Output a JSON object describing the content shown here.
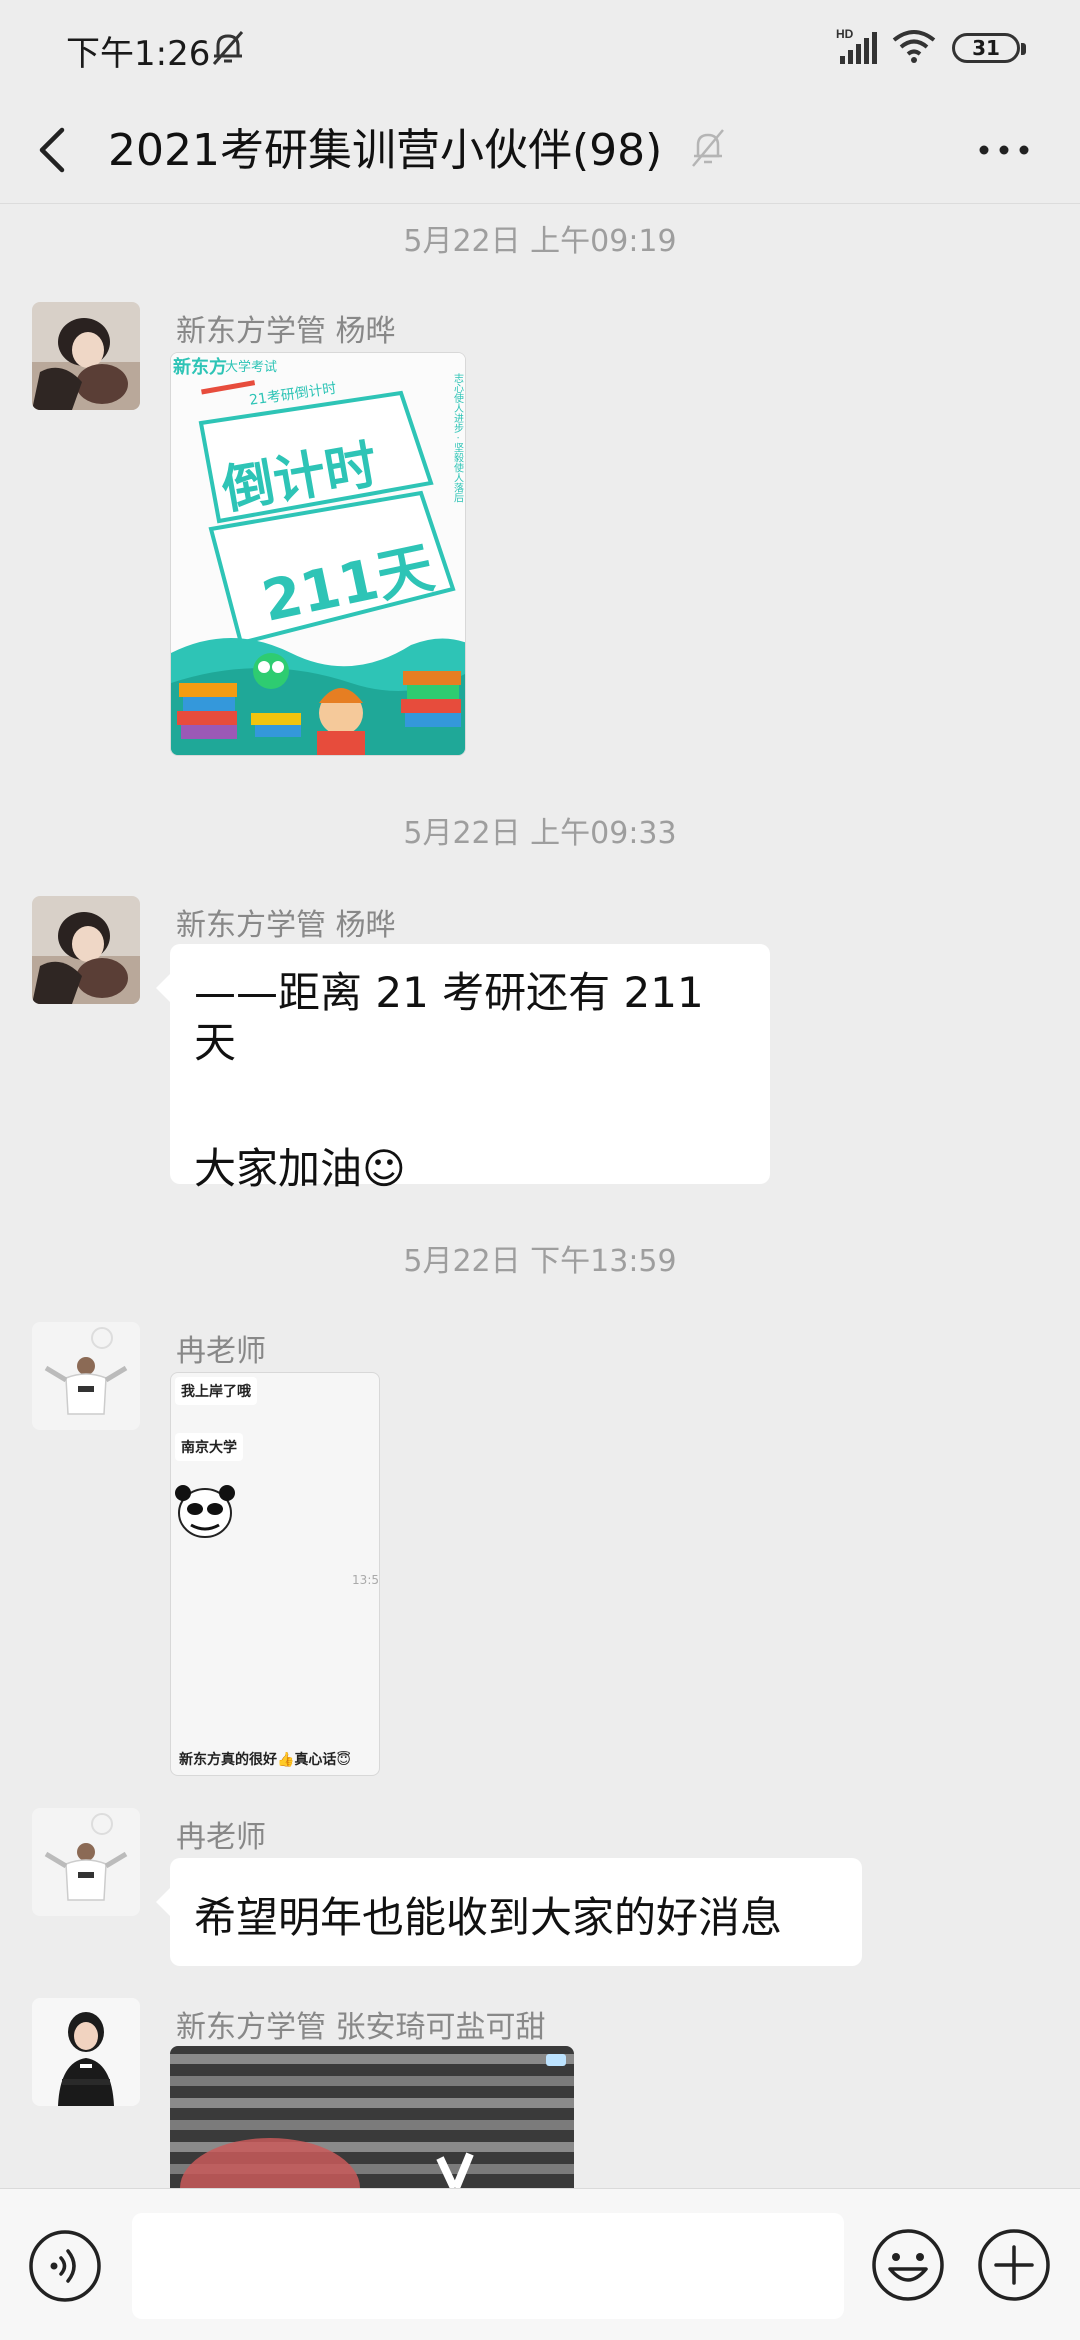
{
  "status_bar": {
    "time": "下午1:26",
    "network_label": "HD",
    "battery": "31"
  },
  "header": {
    "title": "2021考研集训营小伙伴(98)"
  },
  "messages": {
    "ts1": "5月22日 上午09:19",
    "m1_sender": "新东方学管  杨晔",
    "poster": {
      "brand": "新东方",
      "sub": "大学考试",
      "ribbon": "21考研倒计时",
      "big_title": "倒计时",
      "days": "211天",
      "side_text": "志心使人进步 · 坚毅使人落后"
    },
    "ts2": "5月22日 上午09:33",
    "m2_sender": "新东方学管  杨晔",
    "m2_line1": "——距离 21 考研还有 211 天",
    "m2_line2": "大家加油☺",
    "ts3": "5月22日 下午13:59",
    "m3_sender": "冉老师",
    "screenshot": {
      "line1": "我上岸了哦",
      "line2": "南京大学",
      "time": "13:5",
      "caption": "新东方真的很好👍真心话😇"
    },
    "m4_sender": "冉老师",
    "m4_text": "希望明年也能收到大家的好消息",
    "m5_sender": "新东方学管 张安琦可盐可甜"
  },
  "icons": {
    "back": "back-arrow-icon",
    "mute": "bell-off-icon",
    "more": "more-dots-icon",
    "voice": "voice-icon",
    "emoji": "emoji-icon",
    "plus": "plus-icon"
  },
  "colors": {
    "background": "#ededed",
    "bubble": "#ffffff",
    "teal_accent": "#2ec4b6"
  }
}
